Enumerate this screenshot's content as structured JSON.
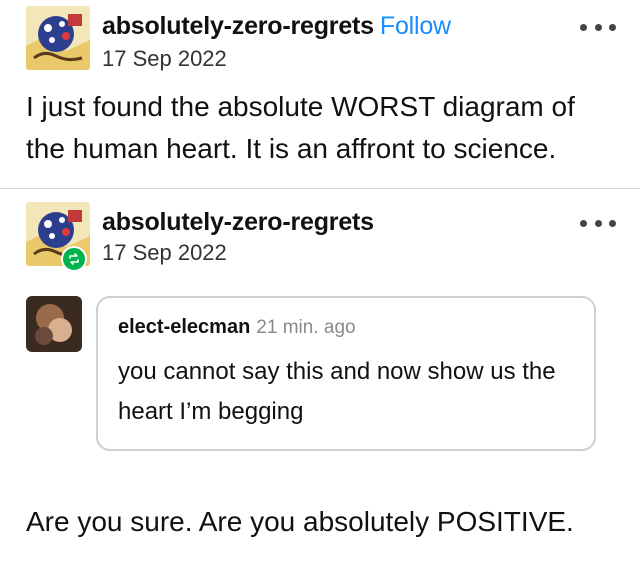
{
  "posts": [
    {
      "username": "absolutely-zero-regrets",
      "follow_label": "Follow",
      "date": "17 Sep 2022",
      "body": "I just found the absolute WORST diagram of the human heart. It is an affront to science."
    },
    {
      "username": "absolutely-zero-regrets",
      "date": "17 Sep 2022",
      "reply": {
        "username": "elect-elecman",
        "time": "21 min. ago",
        "text": "you cannot say this and now show us the heart I’m begging"
      },
      "body": "Are you sure. Are you absolutely POSITIVE."
    }
  ],
  "colors": {
    "follow": "#1a8cff",
    "reblog_badge": "#00b34d",
    "divider": "#d8d8d8"
  },
  "icons": {
    "more": "more-options-icon",
    "reblog": "reblog-icon"
  }
}
